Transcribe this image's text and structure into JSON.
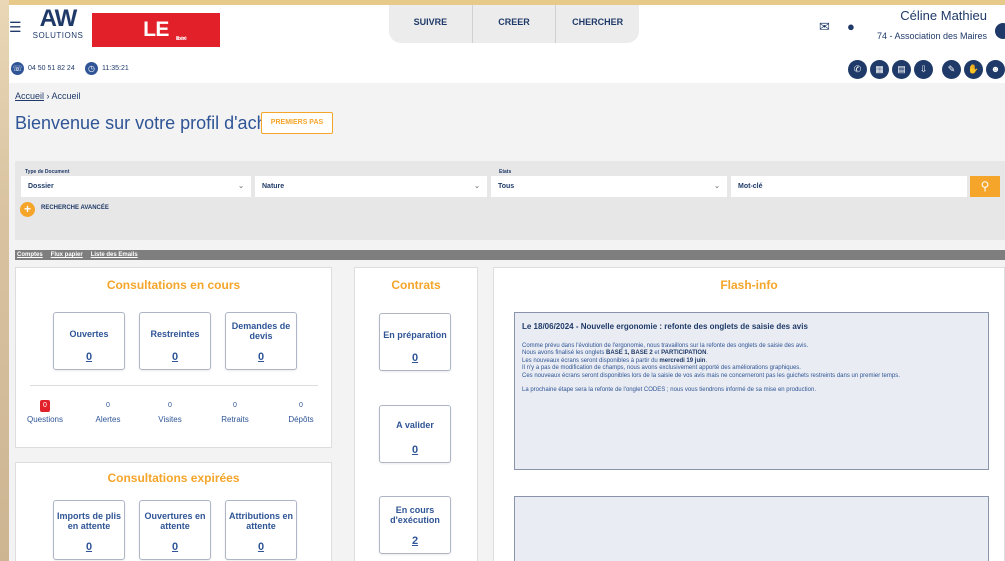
{
  "header": {
    "menu_icon": "hamburger-icon",
    "logo_aw": "AW",
    "logo_solutions": "SOLUTIONS",
    "logo_dauphine": "LE DAUPHINE",
    "logo_dauphine_sub": "libéré",
    "nav": [
      "SUIVRE",
      "CREER",
      "CHERCHER"
    ],
    "user_name": "Céline Mathieu",
    "user_org": "74 - Association des Maires"
  },
  "info_bar": {
    "phone": "04 50 51 82 24",
    "time": "11:35:21",
    "tool_icons": [
      "phone-icon",
      "calculator-icon",
      "document-icon",
      "download-icon",
      "edit-icon",
      "hand-icon",
      "user-icon"
    ]
  },
  "breadcrumb": {
    "link": "Accueil",
    "separator": "›",
    "current": "Accueil"
  },
  "page_title": "Bienvenue sur votre profil d'acheteur",
  "first_steps_label": "PREMIERS PAS",
  "search": {
    "type_label": "Type de Document",
    "type_value": "Dossier",
    "nature_value": "Nature",
    "etats_label": "Etats",
    "etats_value": "Tous",
    "keyword_placeholder": "Mot-clé",
    "advanced_label": "RECHERCHE AVANCÉE"
  },
  "sub_links": [
    "Comptes",
    "Flux papier",
    "Liste des Emails"
  ],
  "consultations_en_cours": {
    "title": "Consultations en cours",
    "cards": [
      {
        "label": "Ouvertes",
        "value": "0"
      },
      {
        "label": "Restreintes",
        "value": "0"
      },
      {
        "label": "Demandes de devis",
        "value": "0"
      }
    ],
    "stats": [
      {
        "label": "Questions",
        "value": "0"
      },
      {
        "label": "Alertes",
        "value": "0"
      },
      {
        "label": "Visites",
        "value": "0"
      },
      {
        "label": "Retraits",
        "value": "0"
      },
      {
        "label": "Dépôts",
        "value": "0"
      }
    ]
  },
  "consultations_expirees": {
    "title": "Consultations expirées",
    "cards": [
      {
        "label": "Imports de plis en attente",
        "value": "0"
      },
      {
        "label": "Ouvertures en attente",
        "value": "0"
      },
      {
        "label": "Attributions en attente",
        "value": "0"
      }
    ]
  },
  "contrats": {
    "title": "Contrats",
    "cards": [
      {
        "label": "En préparation",
        "value": "0"
      },
      {
        "label": "A valider",
        "value": "0"
      },
      {
        "label": "En cours d'exécution",
        "value": "2"
      }
    ]
  },
  "flash_info": {
    "title": "Flash-info",
    "headline": "Le 18/06/2024 - Nouvelle ergonomie : refonte des onglets de saisie des avis",
    "line1": "Comme prévu dans l'évolution de l'ergonomie, nous travaillons sur la refonte des onglets de saisie des avis.",
    "line2_pre": "Nous avons finalisé les onglets ",
    "line2_bold": "BASE 1, BASE 2",
    "line2_mid": " et ",
    "line2_bold2": "PARTICIPATION",
    "line2_post": ".",
    "line3_pre": "Les nouveaux écrans seront disponibles à partir du ",
    "line3_bold": "mercredi 19 juin",
    "line3_post": ".",
    "line4": "Il n'y a pas de modification de champs, nous avons exclusivement apporté des améliorations graphiques.",
    "line5": "Ces nouveaux écrans seront disponibles lors de la saisie de vos avis mais ne concerneront pas les guichets restreints dans un premier temps.",
    "line6": "La prochaine étape sera la refonte de l'onglet CODES ; nous vous tiendrons informé de sa mise en production."
  }
}
